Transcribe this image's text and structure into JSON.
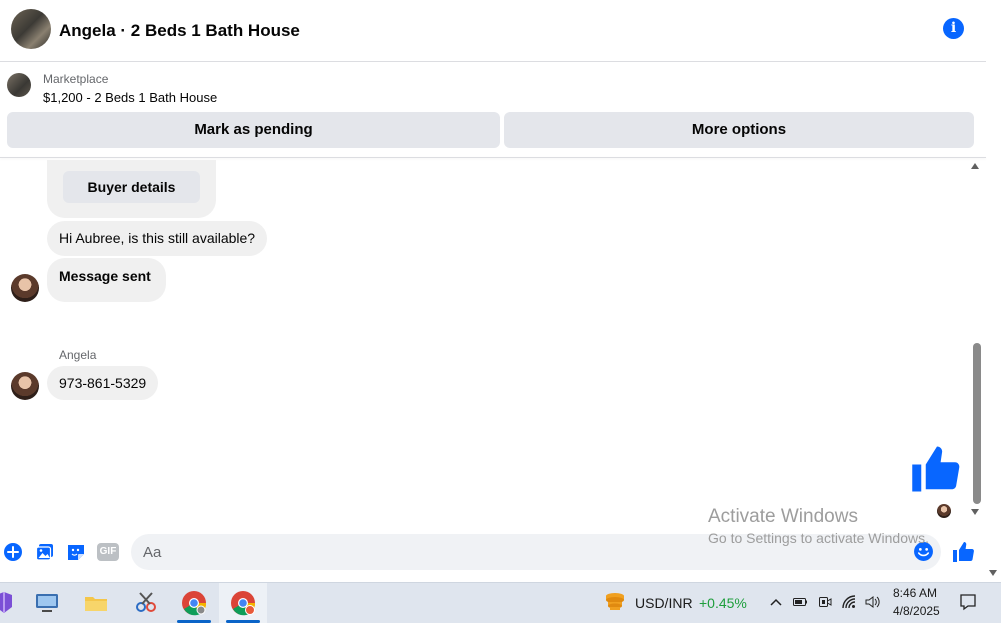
{
  "header": {
    "title": "Angela · 2 Beds 1 Bath House"
  },
  "listing": {
    "source": "Marketplace",
    "title": "$1,200 - 2 Beds 1 Bath House",
    "mark_pending_label": "Mark as pending",
    "more_options_label": "More options"
  },
  "chat": {
    "buyer_details_label": "Buyer details",
    "messages": [
      {
        "text": "Hi Aubree, is this still available?"
      },
      {
        "text": "Message sent"
      },
      {
        "text": "973-861-5329"
      }
    ],
    "sender_name": "Angela"
  },
  "composer": {
    "placeholder": "Aa",
    "gif_label": "GIF"
  },
  "watermark": {
    "title": "Activate Windows",
    "subtitle": "Go to Settings to activate Windows."
  },
  "taskbar": {
    "ticker_pair": "USD/INR",
    "ticker_change": "+0.45%",
    "time": "8:46 AM",
    "date": "4/8/2025"
  },
  "colors": {
    "accent": "#0866ff",
    "bubble": "#f0f0f0",
    "ticker_up": "#1e9e3c"
  }
}
